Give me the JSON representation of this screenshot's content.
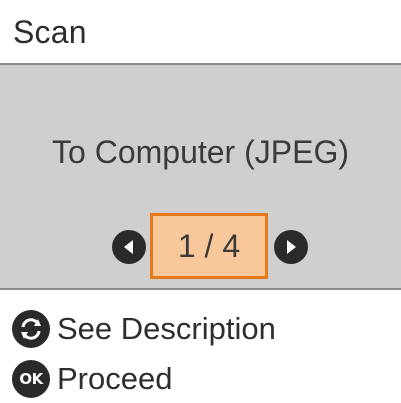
{
  "header": {
    "title": "Scan"
  },
  "main": {
    "mode_label": "To Computer (JPEG)",
    "pager": {
      "current": 1,
      "total": 4,
      "display": "1 / 4"
    }
  },
  "footer": {
    "rotate_icon": "rotate-arrows-icon",
    "see_description_label": "See Description",
    "ok_icon_text": "OK",
    "proceed_label": "Proceed"
  },
  "colors": {
    "panel_gray": "#cfcfcf",
    "highlight_fill": "#f8c79a",
    "highlight_border": "#e8781c",
    "icon_dark": "#2a2a2a"
  }
}
